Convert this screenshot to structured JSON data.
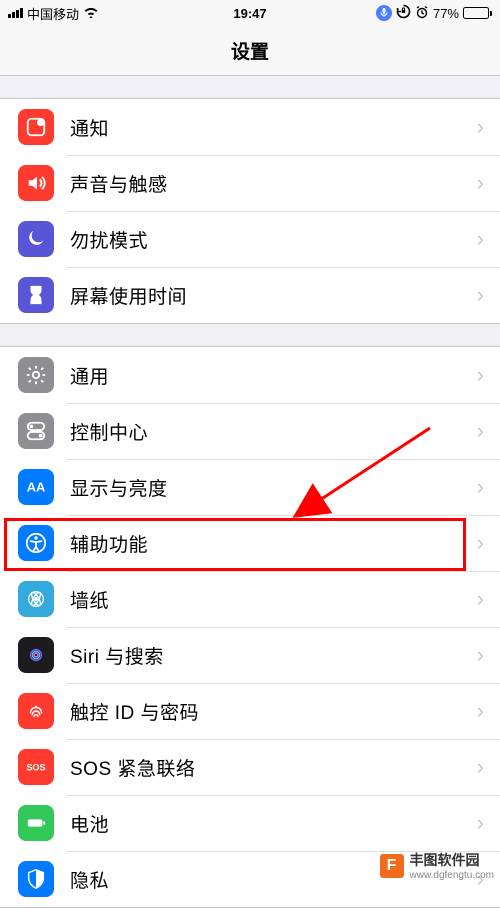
{
  "status": {
    "carrier": "中国移动",
    "time": "19:47",
    "battery_pct": "77%",
    "battery_fill_pct": 77
  },
  "header": {
    "title": "设置"
  },
  "groups": [
    {
      "rows": [
        {
          "icon": "notification-icon",
          "bg": "ic-red",
          "label": "通知"
        },
        {
          "icon": "sound-icon",
          "bg": "ic-pink",
          "label": "声音与触感"
        },
        {
          "icon": "dnd-icon",
          "bg": "ic-purple",
          "label": "勿扰模式"
        },
        {
          "icon": "screentime-icon",
          "bg": "ic-purple",
          "label": "屏幕使用时间"
        }
      ]
    },
    {
      "rows": [
        {
          "icon": "general-icon",
          "bg": "ic-gray",
          "label": "通用"
        },
        {
          "icon": "control-center-icon",
          "bg": "ic-gray",
          "label": "控制中心"
        },
        {
          "icon": "display-icon",
          "bg": "ic-blue",
          "label": "显示与亮度"
        },
        {
          "icon": "accessibility-icon",
          "bg": "ic-blue",
          "label": "辅助功能",
          "highlighted": true
        },
        {
          "icon": "wallpaper-icon",
          "bg": "ic-cyan",
          "label": "墙纸"
        },
        {
          "icon": "siri-icon",
          "bg": "ic-black",
          "label": "Siri 与搜索"
        },
        {
          "icon": "touchid-icon",
          "bg": "ic-red",
          "label": "触控 ID 与密码"
        },
        {
          "icon": "sos-icon",
          "bg": "ic-red",
          "label": "SOS 紧急联络"
        },
        {
          "icon": "battery-icon",
          "bg": "ic-green",
          "label": "电池"
        },
        {
          "icon": "privacy-icon",
          "bg": "ic-blue",
          "label": "隐私"
        }
      ]
    }
  ],
  "watermark": {
    "name": "丰图软件园",
    "url": "www.dgfengtu.com"
  },
  "annotation": {
    "highlight_row_label": "辅助功能",
    "arrow_color": "#f00"
  }
}
